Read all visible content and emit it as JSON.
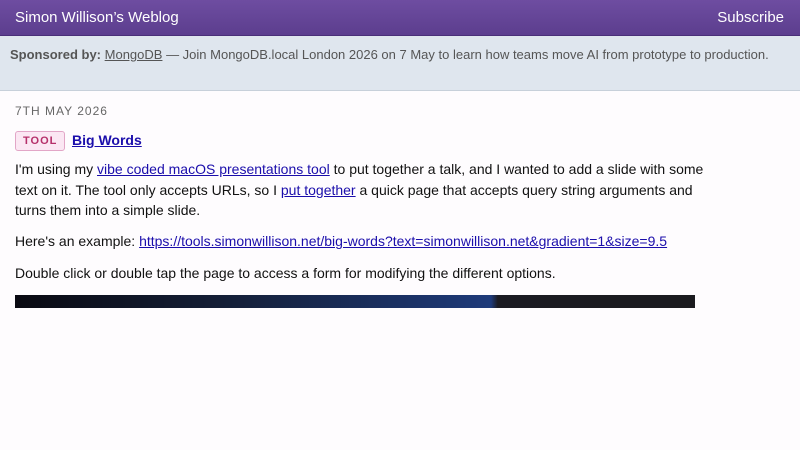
{
  "header": {
    "site_title": "Simon Willison’s Weblog",
    "subscribe_label": "Subscribe"
  },
  "sponsor": {
    "label": "Sponsored by:",
    "sponsor_name": "MongoDB",
    "message": " — Join MongoDB.local London 2026 on 7 May to learn how teams move AI from prototype to production."
  },
  "entry": {
    "date": "7TH MAY 2026",
    "tag": "TOOL",
    "title": "Big Words",
    "p1_before_link1": "I'm using my ",
    "p1_link1": "vibe coded macOS presentations tool",
    "p1_middle": " to put together a talk, and I wanted to add a slide with some text on it. The tool only accepts URLs, so I ",
    "p1_link2": "put together",
    "p1_after": " a quick page that accepts query string arguments and turns them into a simple slide.",
    "p2_before": "Here's an example: ",
    "p2_link": "https://tools.simonwillison.net/big-words?text=simonwillison.net&gradient=1&size=9.5",
    "p3": "Double click or double tap the page to access a form for modifying the different options."
  },
  "colors": {
    "header_bg": "#6e4da1",
    "sponsor_bg": "#dfe6ee",
    "link": "#1a0dab",
    "tag_text": "#b5306a"
  }
}
